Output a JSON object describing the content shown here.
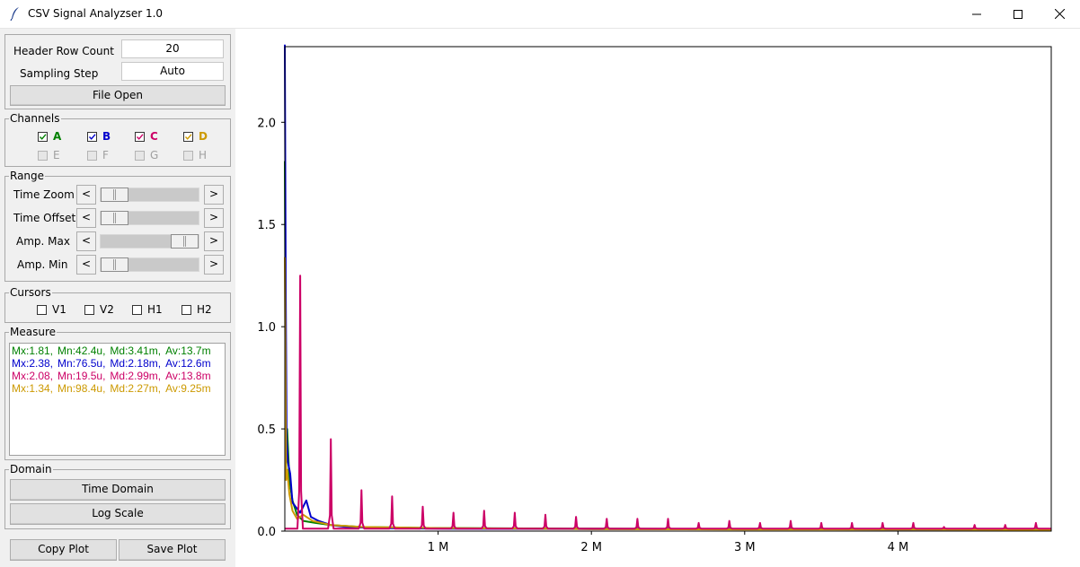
{
  "window": {
    "title": "CSV Signal Analyzser 1.0"
  },
  "file_settings": {
    "header_row_label": "Header Row Count",
    "header_row_value": "20",
    "sampling_label": "Sampling Step",
    "sampling_value": "Auto",
    "open_button": "File Open"
  },
  "channels": {
    "legend": "Channels",
    "items": [
      {
        "label": "A",
        "checked": true,
        "enabled": true,
        "color": "#008000"
      },
      {
        "label": "B",
        "checked": true,
        "enabled": true,
        "color": "#0000cc"
      },
      {
        "label": "C",
        "checked": true,
        "enabled": true,
        "color": "#cc0066"
      },
      {
        "label": "D",
        "checked": true,
        "enabled": true,
        "color": "#cc9900"
      },
      {
        "label": "E",
        "checked": false,
        "enabled": false,
        "color": "#a0a0a0"
      },
      {
        "label": "F",
        "checked": false,
        "enabled": false,
        "color": "#a0a0a0"
      },
      {
        "label": "G",
        "checked": false,
        "enabled": false,
        "color": "#a0a0a0"
      },
      {
        "label": "H",
        "checked": false,
        "enabled": false,
        "color": "#a0a0a0"
      }
    ]
  },
  "range": {
    "legend": "Range",
    "left_arrow": "<",
    "right_arrow": ">",
    "sliders": [
      {
        "label": "Time Zoom",
        "position": 0.0
      },
      {
        "label": "Time Offset",
        "position": 0.0
      },
      {
        "label": "Amp. Max",
        "position": 1.0
      },
      {
        "label": "Amp. Min",
        "position": 0.0
      }
    ]
  },
  "cursors": {
    "legend": "Cursors",
    "items": [
      {
        "label": "V1",
        "checked": false
      },
      {
        "label": "V2",
        "checked": false
      },
      {
        "label": "H1",
        "checked": false
      },
      {
        "label": "H2",
        "checked": false
      }
    ]
  },
  "measure": {
    "legend": "Measure",
    "rows": [
      {
        "color": "#008000",
        "mx": "Mx:1.81,",
        "mn": "Mn:42.4u,",
        "md": "Md:3.41m,",
        "av": "Av:13.7m"
      },
      {
        "color": "#0000cc",
        "mx": "Mx:2.38,",
        "mn": "Mn:76.5u,",
        "md": "Md:2.18m,",
        "av": "Av:12.6m"
      },
      {
        "color": "#cc0066",
        "mx": "Mx:2.08,",
        "mn": "Mn:19.5u,",
        "md": "Md:2.99m,",
        "av": "Av:13.8m"
      },
      {
        "color": "#cc9900",
        "mx": "Mx:1.34,",
        "mn": "Mn:98.4u,",
        "md": "Md:2.27m,",
        "av": "Av:9.25m"
      }
    ]
  },
  "domain": {
    "legend": "Domain",
    "time_button": "Time Domain",
    "log_button": "Log Scale"
  },
  "actions": {
    "copy_button": "Copy Plot",
    "save_button": "Save Plot"
  },
  "chart_data": {
    "type": "line",
    "title": "",
    "xlabel": "",
    "ylabel": "",
    "xlim": [
      0,
      5000000
    ],
    "ylim": [
      0,
      2.37
    ],
    "xticks": [
      {
        "value": 1000000,
        "label": "1 M"
      },
      {
        "value": 2000000,
        "label": "2 M"
      },
      {
        "value": 3000000,
        "label": "3 M"
      },
      {
        "value": 4000000,
        "label": "4 M"
      }
    ],
    "yticks": [
      {
        "value": 0.0,
        "label": "0.0"
      },
      {
        "value": 0.5,
        "label": "0.5"
      },
      {
        "value": 1.0,
        "label": "1.0"
      },
      {
        "value": 1.5,
        "label": "1.5"
      },
      {
        "value": 2.0,
        "label": "2.0"
      }
    ],
    "series": [
      {
        "color": "#008000",
        "points": [
          [
            0,
            1.81
          ],
          [
            8000,
            0.3
          ],
          [
            15000,
            0.5
          ],
          [
            30000,
            0.25
          ],
          [
            50000,
            0.15
          ],
          [
            80000,
            0.08
          ],
          [
            120000,
            0.05
          ],
          [
            200000,
            0.04
          ],
          [
            300000,
            0.03
          ],
          [
            500000,
            0.02
          ],
          [
            1000000,
            0.015
          ],
          [
            2000000,
            0.012
          ],
          [
            3000000,
            0.01
          ],
          [
            4000000,
            0.01
          ],
          [
            5000000,
            0.008
          ]
        ]
      },
      {
        "color": "#0000cc",
        "points": [
          [
            0,
            2.38
          ],
          [
            6000,
            1.2
          ],
          [
            12000,
            0.45
          ],
          [
            20000,
            0.34
          ],
          [
            35000,
            0.28
          ],
          [
            50000,
            0.14
          ],
          [
            70000,
            0.12
          ],
          [
            100000,
            0.09
          ],
          [
            140000,
            0.15
          ],
          [
            170000,
            0.07
          ],
          [
            220000,
            0.05
          ],
          [
            300000,
            0.03
          ],
          [
            400000,
            0.02
          ],
          [
            600000,
            0.015
          ],
          [
            1000000,
            0.012
          ],
          [
            2000000,
            0.01
          ],
          [
            3000000,
            0.01
          ],
          [
            4000000,
            0.008
          ],
          [
            5000000,
            0.008
          ]
        ]
      },
      {
        "color": "#cc9900",
        "points": [
          [
            0,
            1.34
          ],
          [
            8000,
            0.25
          ],
          [
            15000,
            0.3
          ],
          [
            30000,
            0.18
          ],
          [
            50000,
            0.1
          ],
          [
            80000,
            0.06
          ],
          [
            120000,
            0.08
          ],
          [
            180000,
            0.05
          ],
          [
            300000,
            0.03
          ],
          [
            500000,
            0.02
          ],
          [
            1000000,
            0.015
          ],
          [
            2000000,
            0.01
          ],
          [
            3000000,
            0.008
          ],
          [
            4000000,
            0.008
          ],
          [
            5000000,
            0.006
          ]
        ]
      },
      {
        "color": "#cc0066",
        "baseline": 0.012,
        "peaks": [
          [
            100000,
            1.25
          ],
          [
            300000,
            0.45
          ],
          [
            500000,
            0.2
          ],
          [
            700000,
            0.17
          ],
          [
            900000,
            0.12
          ],
          [
            1100000,
            0.09
          ],
          [
            1300000,
            0.1
          ],
          [
            1500000,
            0.09
          ],
          [
            1700000,
            0.08
          ],
          [
            1900000,
            0.07
          ],
          [
            2100000,
            0.06
          ],
          [
            2300000,
            0.06
          ],
          [
            2500000,
            0.06
          ],
          [
            2700000,
            0.04
          ],
          [
            2900000,
            0.05
          ],
          [
            3100000,
            0.04
          ],
          [
            3300000,
            0.05
          ],
          [
            3500000,
            0.04
          ],
          [
            3700000,
            0.04
          ],
          [
            3900000,
            0.04
          ],
          [
            4100000,
            0.04
          ],
          [
            4300000,
            0.02
          ],
          [
            4500000,
            0.03
          ],
          [
            4700000,
            0.03
          ],
          [
            4900000,
            0.04
          ]
        ]
      }
    ]
  }
}
